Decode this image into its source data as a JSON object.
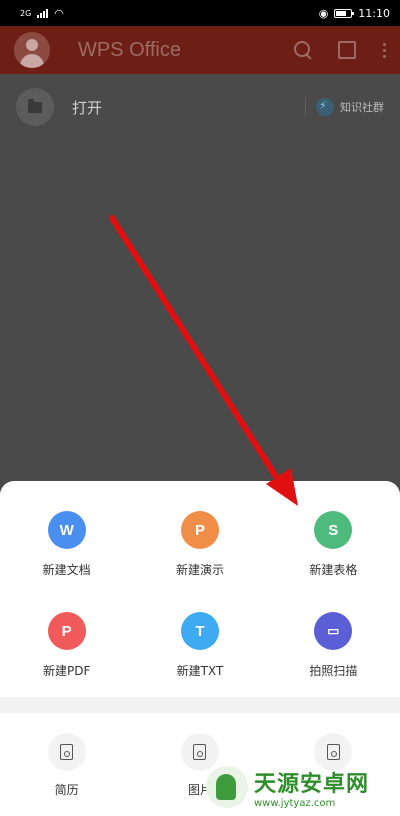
{
  "status_bar": {
    "network": "2G",
    "time": "11:10"
  },
  "app_bar": {
    "title": "WPS Office",
    "icons": [
      "avatar",
      "search-icon",
      "multiwindow-icon",
      "more-icon"
    ]
  },
  "open_row": {
    "label": "打开",
    "community_label": "知识社群",
    "icons": [
      "folder-icon",
      "bolt-icon"
    ]
  },
  "sheet": {
    "create_items": [
      {
        "label": "新建文档",
        "glyph": "W",
        "color": "#4a8ef0"
      },
      {
        "label": "新建演示",
        "glyph": "P",
        "color": "#f08e47"
      },
      {
        "label": "新建表格",
        "glyph": "S",
        "color": "#4ebb7c"
      },
      {
        "label": "新建PDF",
        "glyph": "P",
        "color": "#f05a5a"
      },
      {
        "label": "新建TXT",
        "glyph": "T",
        "color": "#3eaaf2"
      },
      {
        "label": "拍照扫描",
        "glyph": "▭",
        "color": "#5b5fd6"
      }
    ],
    "bottom_items": [
      {
        "label": "简历",
        "icon": "resume-icon"
      },
      {
        "label": "图片",
        "icon": "image-icon"
      },
      {
        "label": "",
        "icon": "edit-icon"
      }
    ]
  },
  "watermark": {
    "brand": "天源安卓网",
    "url": "www.jytyaz.com"
  },
  "annotation": {
    "arrow_color": "#e01010"
  }
}
